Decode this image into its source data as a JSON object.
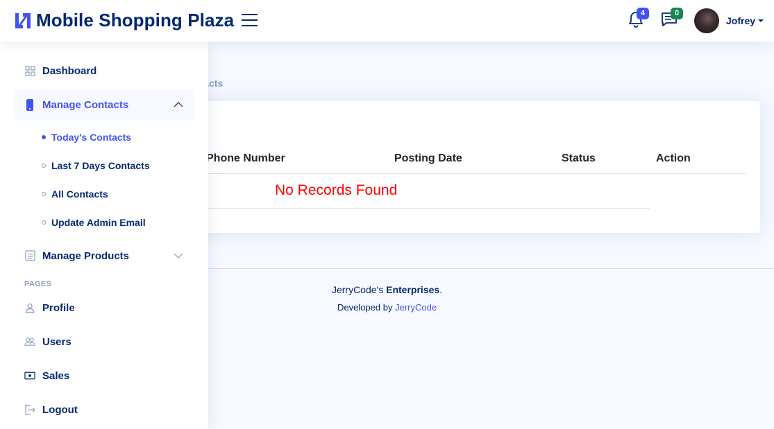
{
  "header": {
    "title": "Mobile Shopping Plaza",
    "notifications_count": "4",
    "messages_count": "0",
    "user_name": "Jofrey"
  },
  "sidebar": {
    "dashboard": "Dashboard",
    "manage_contacts": "Manage Contacts",
    "sub_items": [
      "Today's Contacts",
      "Last 7 Days Contacts",
      "All Contacts",
      "Update Admin Email"
    ],
    "manage_products": "Manage Products",
    "pages_heading": "PAGES",
    "profile": "Profile",
    "users": "Users",
    "sales": "Sales",
    "logout": "Logout"
  },
  "main": {
    "breadcrumb_fragment": "ntacts",
    "table": {
      "columns": [
        "Phone Number",
        "Posting Date",
        "Status",
        "Action"
      ],
      "empty_message": "No Records Found"
    }
  },
  "footer": {
    "copyright_prefix": "JerryCode's ",
    "copyright_strong": "Enterprises",
    "copyright_suffix": ".",
    "credits_prefix": "Developed by ",
    "credits_link": "JerryCode"
  },
  "colors": {
    "primary": "#4154f1",
    "navy": "#012970",
    "badge_green": "#198754",
    "error_red": "#ff0000",
    "background": "#f6f9ff"
  },
  "icons": [
    "logo-icon",
    "hamburger-icon",
    "bell-icon",
    "chat-icon",
    "grid-icon",
    "phone-icon",
    "chevron-up-icon",
    "chevron-down-icon",
    "document-list-icon",
    "person-icon",
    "people-icon",
    "cash-icon",
    "logout-icon"
  ]
}
